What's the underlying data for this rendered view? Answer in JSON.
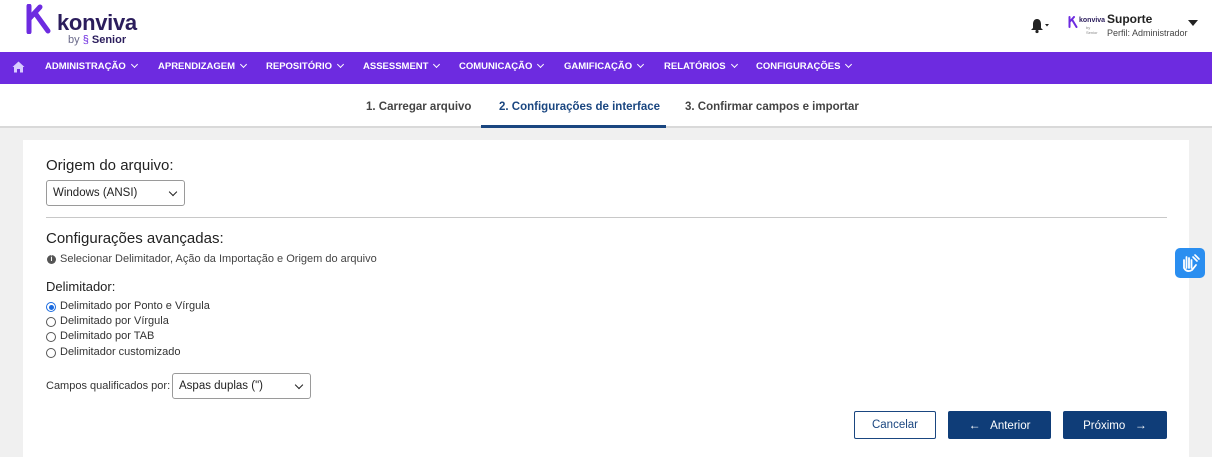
{
  "header": {
    "logo": {
      "word": "konviva",
      "by": "by",
      "brand": "Senior",
      "brand_color": "#6d2be0"
    },
    "user": {
      "logo_word": "konviva",
      "logo_sub": "by Senior",
      "name": "Suporte",
      "role": "Perfil: Administrador"
    }
  },
  "nav": {
    "background": "#6d2be0",
    "items": [
      "ADMINISTRAÇÃO",
      "APRENDIZAGEM",
      "REPOSITÓRIO",
      "ASSESSMENT",
      "COMUNICAÇÃO",
      "GAMIFICAÇÃO",
      "RELATÓRIOS",
      "CONFIGURAÇÕES"
    ]
  },
  "steps": [
    {
      "label": "1. Carregar arquivo",
      "active": false
    },
    {
      "label": "2. Configurações de interface",
      "active": true
    },
    {
      "label": "3. Confirmar campos e importar",
      "active": false
    }
  ],
  "form": {
    "origem_title": "Origem do arquivo:",
    "origem_value": "Windows (ANSI)",
    "advanced_title": "Configurações avançadas:",
    "advanced_info": "Selecionar Delimitador, Ação da Importação e Origem do arquivo",
    "delimiter_title": "Delimitador:",
    "delimiters": [
      {
        "label": "Delimitado por Ponto e Vírgula",
        "checked": true
      },
      {
        "label": "Delimitado por Vírgula",
        "checked": false
      },
      {
        "label": "Delimitado por TAB",
        "checked": false
      },
      {
        "label": "Delimitador customizado",
        "checked": false
      }
    ],
    "campos_label": "Campos qualificados por:",
    "campos_value": "Aspas duplas (\")"
  },
  "buttons": {
    "cancel": "Cancelar",
    "previous": "Anterior",
    "next": "Próximo"
  },
  "icons": {
    "home": "home-icon",
    "bell": "bell-icon",
    "accessibility": "sign-language-hands-icon"
  }
}
